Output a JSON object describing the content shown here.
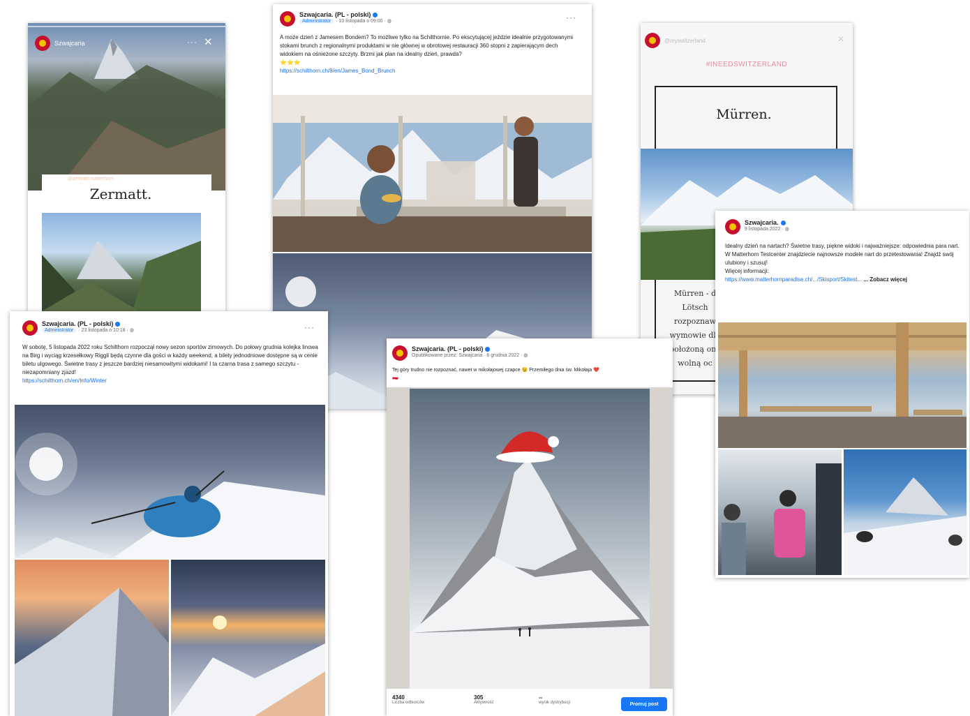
{
  "page": "Szwajcaria social media posts collage",
  "colors": {
    "accent_blue": "#1877f2",
    "link": "#216fdb",
    "hashtag": "#e8899a",
    "brand_red": "#c8102e"
  },
  "story_zermatt": {
    "account": "Szwajcaria",
    "tag": "@zermatt.matterhorn",
    "title": "Zermatt."
  },
  "post_bond": {
    "page_name": "Szwajcaria. (PL - polski)",
    "author_badge": "Administrator",
    "timestamp": "· 10 listopada o 09:00 ·",
    "text": "A może dzień z Jamesem Bondem? To możliwe tylko na Schilthornie. Po ekscytującej jeździe idealnie przygotowanymi stokami brunch z regionalnymi produktami w nie głównej w obrotowej restauracji 360 stopni z zapierającym dech widokiem na ośnieżone szczyty. Brzmi jak plan na idealny dzień, prawda?",
    "emoji": "⭐⭐⭐",
    "link": "https://schilthorn.ch/8/en/James_Bond_Brunch"
  },
  "story_murren": {
    "account": "@myswitzerland",
    "hashtag": "#INEEDSWITZERLAND",
    "title": "Mürren.",
    "body_lines": [
      "Mürren - d",
      "Lötsch",
      "rozpoznaw",
      "wymowie dla",
      "położoną ona",
      "wolną oc"
    ]
  },
  "post_season": {
    "page_name": "Szwajcaria. (PL - polski)",
    "author_badge": "Administrator",
    "timestamp": "· 23 listopada o 10:18 ·",
    "text": "W sobotę, 5 listopada 2022 roku Schilthorn rozpoczął nowy sezon sportów zimowych. Do połowy grudnia kolejka linowa na Birg i wyciąg krzesełkowy Riggli będą czynne dla gości w każdy weekend, a bilety jednodniowe dostępne są w cenie biletu ulgowego. Świetne trasy z jeszcze bardziej niesamowitymi widokami! I ta czarna trasa z samego szczytu - niezapomniany zjazd!",
    "link": "https://schilthorn.ch/en/Info/Winter"
  },
  "post_matterhorn": {
    "page_name": "Szwajcaria. (PL - polski)",
    "sub": "Opublikowane przez: Szwajcaria",
    "timestamp": "· 6 grudnia 2022 ·",
    "text": "Tej góry trudno nie rozpoznać, nawet w mikołajowej czapce 😉 Przemiłego dnia św. Mikołaja ❤️🇵🇱",
    "stats": [
      {
        "value": "4340",
        "label": "Liczba odbiorców"
      },
      {
        "value": "305",
        "label": "Aktywność"
      },
      {
        "value": "--",
        "label": "wynik dystrybucji"
      }
    ],
    "boost_button": "Promuj post"
  },
  "post_ski": {
    "page_name": "Szwajcaria.",
    "timestamp": "9 listopada 2022 ·",
    "text": "Idealny dzień na nartach? Świetne trasy, piękne widoki i najważniejsze: odpowiednia para nart. W Matterhorn Testcenter znajdziecie najnowsze modele nart do przetestowania! Znajdź swój ulubiony i szusuj!",
    "more_info": "Więcej informacji:",
    "link": "https://www.matterhornparadise.ch/.../Skisport/Skitest...",
    "see_more": "... Zobacz więcej"
  }
}
